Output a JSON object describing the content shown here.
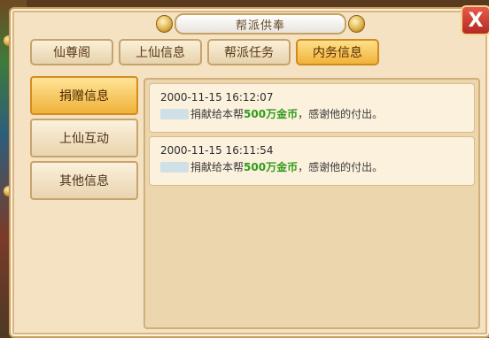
{
  "window": {
    "title": "帮派供奉",
    "close_glyph": "X"
  },
  "tabs": [
    {
      "label": "仙尊阁",
      "active": false
    },
    {
      "label": "上仙信息",
      "active": false
    },
    {
      "label": "帮派任务",
      "active": false
    },
    {
      "label": "内务信息",
      "active": true
    }
  ],
  "sidebar": {
    "items": [
      {
        "label": "捐赠信息",
        "active": true
      },
      {
        "label": "上仙互动",
        "active": false
      },
      {
        "label": "其他信息",
        "active": false
      }
    ]
  },
  "messages": [
    {
      "time": "2000-11-15 16:12:07",
      "prefix": "捐献给本帮",
      "amount": "500万金币",
      "suffix": "，感谢他的付出。"
    },
    {
      "time": "2000-11-15 16:11:54",
      "prefix": "捐献给本帮",
      "amount": "500万金币",
      "suffix": "，感谢他的付出。"
    }
  ],
  "colors": {
    "accent": "#f0b33a",
    "amount": "#2f9c1a",
    "close": "#c53a2c"
  }
}
